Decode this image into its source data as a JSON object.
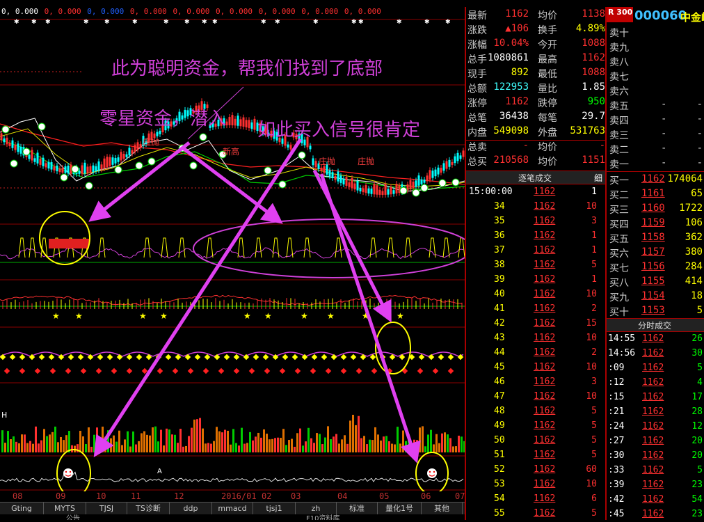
{
  "ma_row": [
    "0, 0.000",
    "0, 0.000",
    "0, 0.000",
    "0, 0.000",
    "0, 0.000",
    "0, 0.000",
    "0, 0.000",
    "0, 0.000",
    "0, 0.000"
  ],
  "annotations": {
    "smart_money": "此为聪明资金，帮我们找到了底部",
    "scattered_money": "零星资金，潜入",
    "buy_signal": "如此买入信号很肯定"
  },
  "chart_marks": {
    "chart_label_1": "庄抛",
    "chart_label_2": "庄抛",
    "chart_label_3": "庄抛",
    "chart_label_4": "新高",
    "volume_letter": "H",
    "bottom_letter": "A"
  },
  "date_axis": [
    "08",
    "09",
    "10",
    "11",
    "12",
    "2016/01",
    "02",
    "03",
    "04",
    "05",
    "06",
    "07"
  ],
  "tabs": [
    "Gting",
    "MYTS",
    "TJSJ",
    "TS诊断",
    "ddp",
    "mmacd",
    "tjsj1",
    "zh",
    "标准",
    "量化1号",
    "其他"
  ],
  "bottom_tabs": [
    "公告",
    "F10资料库"
  ],
  "quote": {
    "rows": [
      {
        "l1": "最新",
        "v1": "1162",
        "l2": "均价",
        "v2": "1138"
      },
      {
        "l1": "涨跌",
        "v1": "▲106",
        "l2": "换手",
        "v2": "4.89%"
      },
      {
        "l1": "涨幅",
        "v1": "10.04%",
        "l2": "今开",
        "v2": "1088"
      },
      {
        "l1": "总手",
        "v1": "1080861",
        "l2": "最高",
        "v2": "1162"
      },
      {
        "l1": "现手",
        "v1": "892",
        "l2": "最低",
        "v2": "1088"
      },
      {
        "l1": "总额",
        "v1": "122953",
        "l2": "量比",
        "v2": "1.85"
      },
      {
        "l1": "涨停",
        "v1": "1162",
        "l2": "跌停",
        "v2": "950"
      },
      {
        "l1": "总笔",
        "v1": "36438",
        "l2": "每笔",
        "v2": "29.7"
      },
      {
        "l1": "内盘",
        "v1": "549098",
        "l2": "外盘",
        "v2": "531763"
      },
      {
        "l1": "总卖",
        "v1": "-",
        "l2": "均价",
        "v2": "-"
      },
      {
        "l1": "总买",
        "v1": "210568",
        "l2": "均价",
        "v2": "1151"
      }
    ]
  },
  "trade_panel": {
    "title": "逐笔成交",
    "detail": "细",
    "time_header": "15:00:00",
    "rows": [
      {
        "seq": "34",
        "price": "1162",
        "vol": "10"
      },
      {
        "seq": "35",
        "price": "1162",
        "vol": "3"
      },
      {
        "seq": "36",
        "price": "1162",
        "vol": "1"
      },
      {
        "seq": "37",
        "price": "1162",
        "vol": "1"
      },
      {
        "seq": "38",
        "price": "1162",
        "vol": "5"
      },
      {
        "seq": "39",
        "price": "1162",
        "vol": "1"
      },
      {
        "seq": "40",
        "price": "1162",
        "vol": "10"
      },
      {
        "seq": "41",
        "price": "1162",
        "vol": "2"
      },
      {
        "seq": "42",
        "price": "1162",
        "vol": "15"
      },
      {
        "seq": "43",
        "price": "1162",
        "vol": "10"
      },
      {
        "seq": "44",
        "price": "1162",
        "vol": "2"
      },
      {
        "seq": "45",
        "price": "1162",
        "vol": "10"
      },
      {
        "seq": "46",
        "price": "1162",
        "vol": "3"
      },
      {
        "seq": "47",
        "price": "1162",
        "vol": "10"
      },
      {
        "seq": "48",
        "price": "1162",
        "vol": "5"
      },
      {
        "seq": "49",
        "price": "1162",
        "vol": "5"
      },
      {
        "seq": "50",
        "price": "1162",
        "vol": "5"
      },
      {
        "seq": "51",
        "price": "1162",
        "vol": "5"
      },
      {
        "seq": "52",
        "price": "1162",
        "vol": "60"
      },
      {
        "seq": "53",
        "price": "1162",
        "vol": "10"
      },
      {
        "seq": "54",
        "price": "1162",
        "vol": "6"
      },
      {
        "seq": "55",
        "price": "1162",
        "vol": "5"
      }
    ]
  },
  "book": {
    "badge": "R 300",
    "code": "000060",
    "name": "中金岭",
    "asks": [
      {
        "label": "卖十",
        "price": "",
        "vol": ""
      },
      {
        "label": "卖九",
        "price": "",
        "vol": ""
      },
      {
        "label": "卖八",
        "price": "",
        "vol": ""
      },
      {
        "label": "卖七",
        "price": "",
        "vol": ""
      },
      {
        "label": "卖六",
        "price": "",
        "vol": ""
      },
      {
        "label": "卖五",
        "price": "-",
        "vol": "-"
      },
      {
        "label": "卖四",
        "price": "-",
        "vol": "-"
      },
      {
        "label": "卖三",
        "price": "-",
        "vol": "-"
      },
      {
        "label": "卖二",
        "price": "-",
        "vol": "-"
      },
      {
        "label": "卖一",
        "price": "-",
        "vol": "-"
      }
    ],
    "bids": [
      {
        "label": "买一",
        "price": "1162",
        "vol": "174064"
      },
      {
        "label": "买二",
        "price": "1161",
        "vol": "65"
      },
      {
        "label": "买三",
        "price": "1160",
        "vol": "1722"
      },
      {
        "label": "买四",
        "price": "1159",
        "vol": "106"
      },
      {
        "label": "买五",
        "price": "1158",
        "vol": "362"
      },
      {
        "label": "买六",
        "price": "1157",
        "vol": "380"
      },
      {
        "label": "买七",
        "price": "1156",
        "vol": "284"
      },
      {
        "label": "买八",
        "price": "1155",
        "vol": "414"
      },
      {
        "label": "买九",
        "price": "1154",
        "vol": "18"
      },
      {
        "label": "买十",
        "price": "1153",
        "vol": "5"
      }
    ]
  },
  "ticks": {
    "title": "分时成交",
    "rows": [
      {
        "time": "14:55",
        "price": "1162",
        "vol": "26"
      },
      {
        "time": "14:56",
        "price": "1162",
        "vol": "30"
      },
      {
        "time": ":09",
        "price": "1162",
        "vol": "5"
      },
      {
        "time": ":12",
        "price": "1162",
        "vol": "4"
      },
      {
        "time": ":15",
        "price": "1162",
        "vol": "17"
      },
      {
        "time": ":21",
        "price": "1162",
        "vol": "28"
      },
      {
        "time": ":24",
        "price": "1162",
        "vol": "12"
      },
      {
        "time": ":27",
        "price": "1162",
        "vol": "20"
      },
      {
        "time": ":30",
        "price": "1162",
        "vol": "20"
      },
      {
        "time": ":33",
        "price": "1162",
        "vol": "5"
      },
      {
        "time": ":39",
        "price": "1162",
        "vol": "23"
      },
      {
        "time": ":42",
        "price": "1162",
        "vol": "54"
      },
      {
        "time": ":45",
        "price": "1162",
        "vol": "23"
      }
    ]
  },
  "colors": {
    "up": "#ff3030",
    "down": "#00ff00",
    "annotation": "#d040d8",
    "highlight": "#ffff00"
  }
}
